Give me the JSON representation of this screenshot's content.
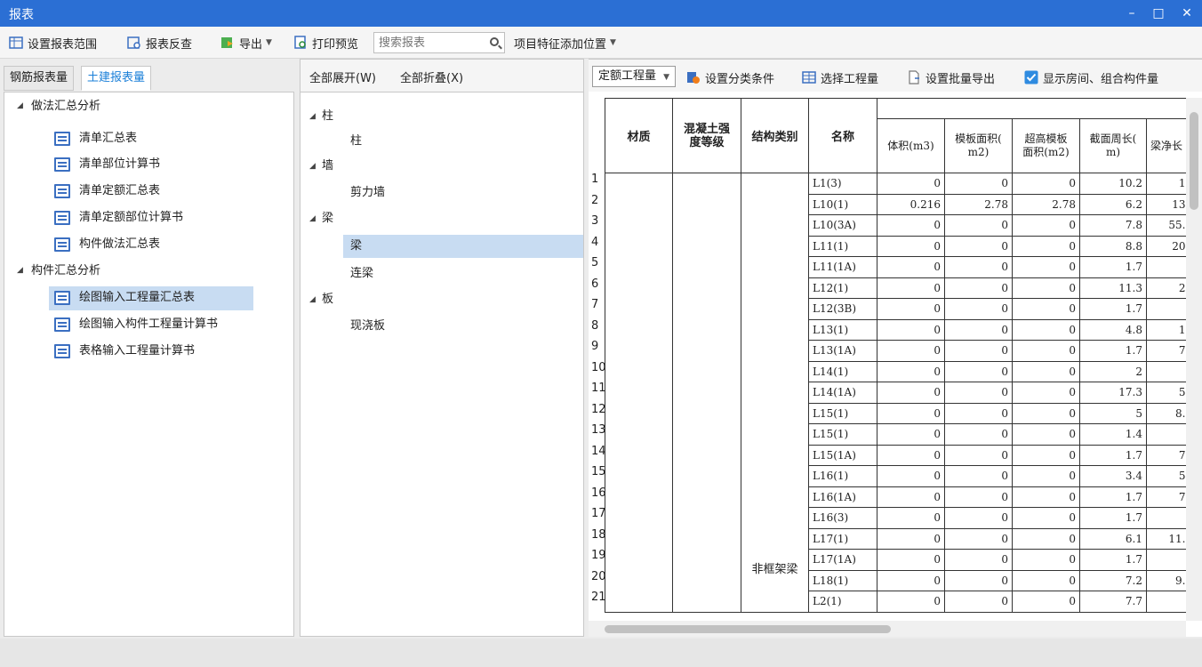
{
  "window": {
    "title": "报表",
    "min": "–",
    "max": "□",
    "close": "✕"
  },
  "toolbar": {
    "set_range": "设置报表范围",
    "reverse": "报表反查",
    "export": "导出",
    "print_preview": "打印预览",
    "search_placeholder": "搜索报表",
    "add_position": "项目特征添加位置"
  },
  "left": {
    "tabs": [
      "钢筋报表量",
      "土建报表量"
    ],
    "groups": [
      {
        "label": "做法汇总分析",
        "items": [
          "清单汇总表",
          "清单部位计算书",
          "清单定额汇总表",
          "清单定额部位计算书",
          "构件做法汇总表"
        ]
      },
      {
        "label": "构件汇总分析",
        "items": [
          "绘图输入工程量汇总表",
          "绘图输入构件工程量计算书",
          "表格输入工程量计算书"
        ]
      }
    ],
    "selected": "绘图输入工程量汇总表"
  },
  "middle": {
    "expand_all": "全部展开(W)",
    "collapse_all": "全部折叠(X)",
    "tree": [
      {
        "label": "柱",
        "children": [
          "柱"
        ]
      },
      {
        "label": "墙",
        "children": [
          "剪力墙"
        ]
      },
      {
        "label": "梁",
        "children": [
          "梁",
          "连梁"
        ]
      },
      {
        "label": "板",
        "children": [
          "现浇板"
        ]
      }
    ],
    "selected": "梁"
  },
  "right": {
    "mode": "定额工程量",
    "set_category": "设置分类条件",
    "select_quantity": "选择工程量",
    "set_batch_export": "设置批量导出",
    "show_room": "显示房间、组合构件量",
    "show_room_checked": true,
    "headers": [
      "材质",
      "混凝土强度等级",
      "结构类别",
      "名称",
      "体积(m3)",
      "模板面积(m2)",
      "超高模板面积(m2)",
      "截面周长(m)",
      "梁净长"
    ],
    "header_lines": {
      "c2": [
        "混凝土强",
        "度等级"
      ],
      "c5": [
        "模板面积(",
        "m2)"
      ],
      "c6": [
        "超高模板",
        "面积(m2)"
      ],
      "c7": [
        "截面周长(",
        "m)"
      ],
      "c8": "梁净长"
    },
    "struct_label": "非框架梁",
    "rows": [
      {
        "n": "1",
        "name": "L1(3)",
        "vol": "0",
        "form": "0",
        "hform": "0",
        "peri": "10.2",
        "len": "1"
      },
      {
        "n": "2",
        "name": "L10(1)",
        "vol": "0.216",
        "form": "2.78",
        "hform": "2.78",
        "peri": "6.2",
        "len": "13"
      },
      {
        "n": "3",
        "name": "L10(3A)",
        "vol": "0",
        "form": "0",
        "hform": "0",
        "peri": "7.8",
        "len": "55."
      },
      {
        "n": "4",
        "name": "L11(1)",
        "vol": "0",
        "form": "0",
        "hform": "0",
        "peri": "8.8",
        "len": "20"
      },
      {
        "n": "5",
        "name": "L11(1A)",
        "vol": "0",
        "form": "0",
        "hform": "0",
        "peri": "1.7",
        "len": ""
      },
      {
        "n": "6",
        "name": "L12(1)",
        "vol": "0",
        "form": "0",
        "hform": "0",
        "peri": "11.3",
        "len": "2"
      },
      {
        "n": "7",
        "name": "L12(3B)",
        "vol": "0",
        "form": "0",
        "hform": "0",
        "peri": "1.7",
        "len": ""
      },
      {
        "n": "8",
        "name": "L13(1)",
        "vol": "0",
        "form": "0",
        "hform": "0",
        "peri": "4.8",
        "len": "1"
      },
      {
        "n": "9",
        "name": "L13(1A)",
        "vol": "0",
        "form": "0",
        "hform": "0",
        "peri": "1.7",
        "len": "7"
      },
      {
        "n": "10",
        "name": "L14(1)",
        "vol": "0",
        "form": "0",
        "hform": "0",
        "peri": "2",
        "len": ""
      },
      {
        "n": "11",
        "name": "L14(1A)",
        "vol": "0",
        "form": "0",
        "hform": "0",
        "peri": "17.3",
        "len": "5"
      },
      {
        "n": "12",
        "name": "L15(1)",
        "vol": "0",
        "form": "0",
        "hform": "0",
        "peri": "5",
        "len": "8."
      },
      {
        "n": "13",
        "name": "L15(1)",
        "vol": "0",
        "form": "0",
        "hform": "0",
        "peri": "1.4",
        "len": ""
      },
      {
        "n": "14",
        "name": "L15(1A)",
        "vol": "0",
        "form": "0",
        "hform": "0",
        "peri": "1.7",
        "len": "7"
      },
      {
        "n": "15",
        "name": "L16(1)",
        "vol": "0",
        "form": "0",
        "hform": "0",
        "peri": "3.4",
        "len": "5"
      },
      {
        "n": "16",
        "name": "L16(1A)",
        "vol": "0",
        "form": "0",
        "hform": "0",
        "peri": "1.7",
        "len": "7"
      },
      {
        "n": "17",
        "name": "L16(3)",
        "vol": "0",
        "form": "0",
        "hform": "0",
        "peri": "1.7",
        "len": ""
      },
      {
        "n": "18",
        "name": "L17(1)",
        "vol": "0",
        "form": "0",
        "hform": "0",
        "peri": "6.1",
        "len": "11."
      },
      {
        "n": "19",
        "name": "L17(1A)",
        "vol": "0",
        "form": "0",
        "hform": "0",
        "peri": "1.7",
        "len": ""
      },
      {
        "n": "20",
        "name": "L18(1)",
        "vol": "0",
        "form": "0",
        "hform": "0",
        "peri": "7.2",
        "len": "9."
      },
      {
        "n": "21",
        "name": "L2(1)",
        "vol": "0",
        "form": "0",
        "hform": "0",
        "peri": "7.7",
        "len": ""
      }
    ]
  },
  "colors": {
    "titlebar": "#2b6fd4",
    "accent": "#1a7fd8",
    "selection": "#c8dcf2"
  }
}
